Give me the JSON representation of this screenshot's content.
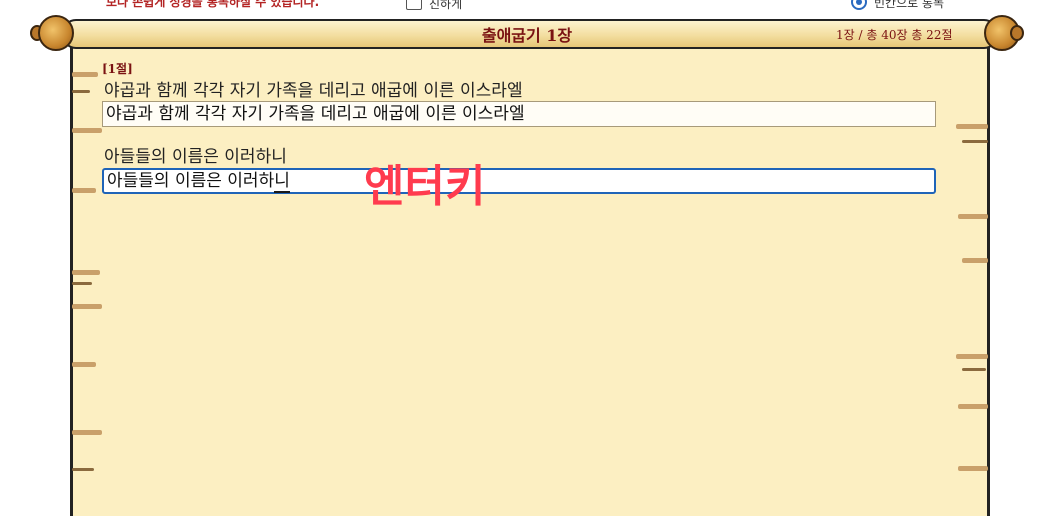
{
  "top_bar": {
    "notice": "보다 손쉽게 성경을 통독하실 수 있습니다.",
    "checkbox_label": "진하게",
    "radio_label": "빈칸으로 통독"
  },
  "header": {
    "chapter_title": "출애굽기 1장",
    "chapter_info": "1장 / 총 40장   총 22절"
  },
  "verses": [
    {
      "number": "[1절]",
      "lines": [
        {
          "text": "야곱과 함께 각각 자기 가족을 데리고 애굽에 이른 이스라엘",
          "typed": "야곱과 함께 각각 자기 가족을 데리고 애굽에 이른 이스라엘"
        },
        {
          "text": "아들들의 이름은 이러하니",
          "typed_prefix": "아들들의 이름은 이러하",
          "typed_last": "니"
        }
      ]
    }
  ],
  "annotation": "엔터키"
}
